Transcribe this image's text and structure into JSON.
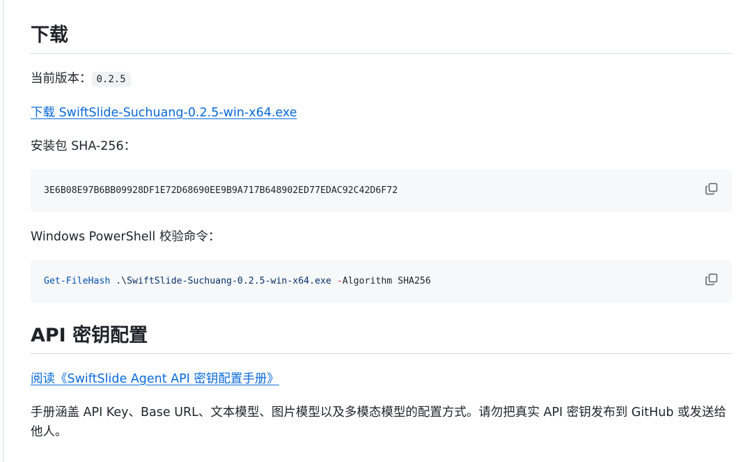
{
  "download": {
    "heading": "下载",
    "version_label": "当前版本：",
    "version_value": "0.2.5",
    "download_link": "下载 SwiftSlide-Suchuang-0.2.5-win-x64.exe",
    "sha_label": "安装包 SHA-256：",
    "sha_value": "3E6B08E97B6BB09928DF1E72D68690EE9B9A717B648902ED77EDAC92C42D6F72",
    "ps_label": "Windows PowerShell 校验命令：",
    "ps_command": {
      "cmd": "Get-FileHash",
      "arg_prefix": " .\\",
      "path": "SwiftSlide-Suchuang-0.2.5-win-x64.exe",
      "space": " ",
      "flag": "-",
      "flag_rest": "Algorithm SHA256"
    },
    "copy_icon": "copy-icon"
  },
  "api": {
    "heading": "API 密钥配置",
    "manual_link": "阅读《SwiftSlide Agent API 密钥配置手册》",
    "description": "手册涵盖 API Key、Base URL、文本模型、图片模型以及多模态模型的配置方式。请勿把真实 API 密钥发布到 GitHub 或发送给他人。"
  },
  "colors": {
    "link": "#0969da",
    "code_bg": "#f6f8fa",
    "text": "#1f2328"
  }
}
